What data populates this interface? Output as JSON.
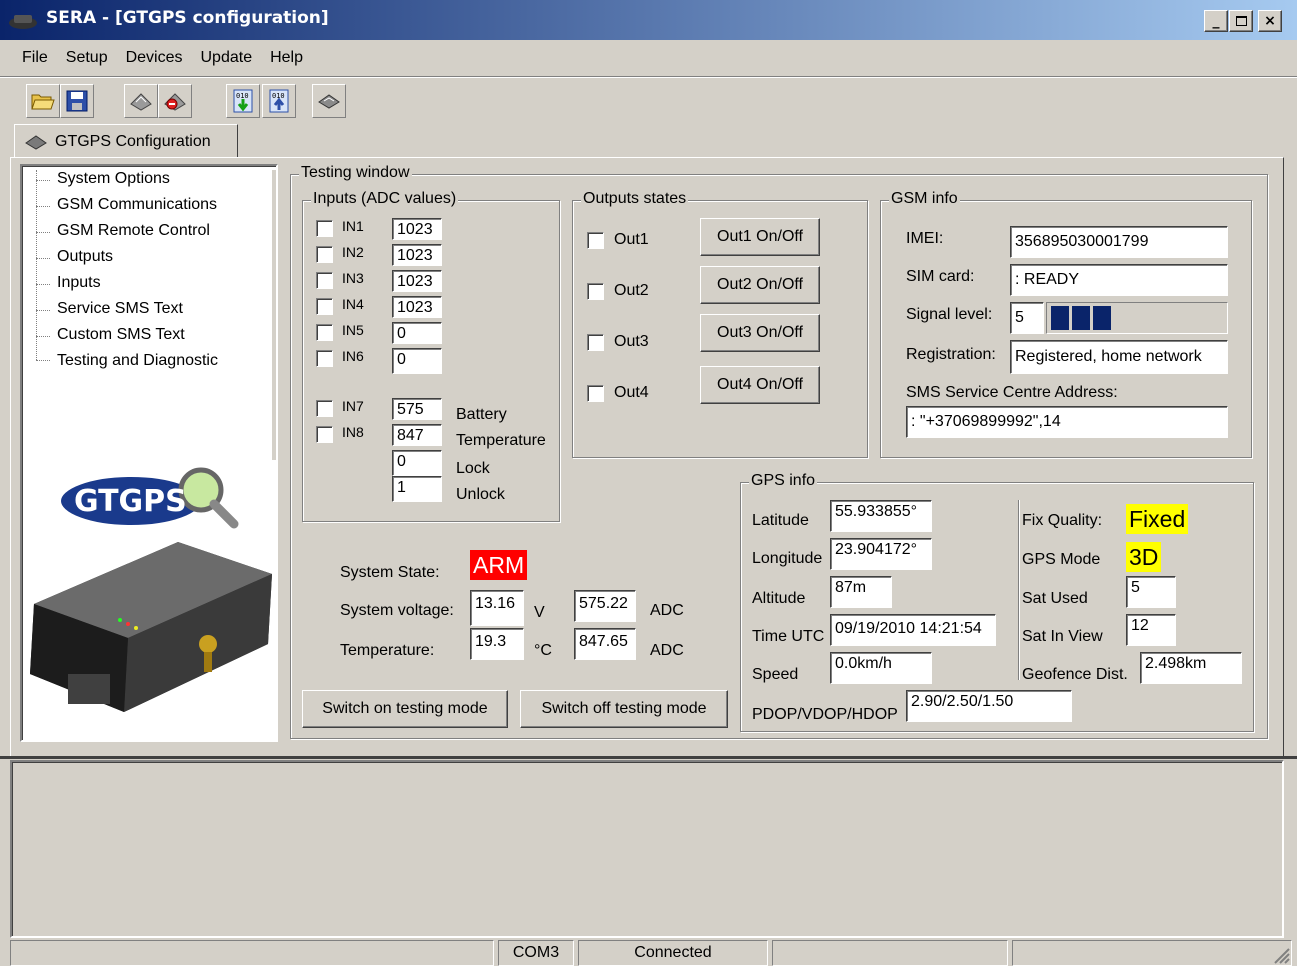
{
  "window": {
    "title": "SERA - [GTGPS configuration]"
  },
  "menu": [
    "File",
    "Setup",
    "Devices",
    "Update",
    "Help"
  ],
  "tab": {
    "label": "GTGPS Configuration"
  },
  "tree": [
    "System Options",
    "GSM Communications",
    "GSM Remote Control",
    "Outputs",
    "Inputs",
    "Service SMS Text",
    "Custom SMS Text",
    "Testing and Diagnostic"
  ],
  "logo": {
    "text": "GTGPS"
  },
  "testing": {
    "title": "Testing window",
    "inputs": {
      "title": "Inputs (ADC values)",
      "items": [
        {
          "name": "IN1",
          "value": "1023"
        },
        {
          "name": "IN2",
          "value": "1023"
        },
        {
          "name": "IN3",
          "value": "1023"
        },
        {
          "name": "IN4",
          "value": "1023"
        },
        {
          "name": "IN5",
          "value": "0"
        },
        {
          "name": "IN6",
          "value": "0"
        },
        {
          "name": "IN7",
          "value": "575",
          "label": "Battery"
        },
        {
          "name": "IN8",
          "value": "847",
          "label": "Temperature"
        }
      ],
      "lock_value": "0",
      "lock_label": "Lock",
      "unlock_value": "1",
      "unlock_label": "Unlock"
    },
    "outputs": {
      "title": "Outputs states",
      "items": [
        {
          "name": "Out1",
          "button": "Out1 On/Off"
        },
        {
          "name": "Out2",
          "button": "Out2 On/Off"
        },
        {
          "name": "Out3",
          "button": "Out3 On/Off"
        },
        {
          "name": "Out4",
          "button": "Out4 On/Off"
        }
      ]
    },
    "gsm": {
      "title": "GSM info",
      "imei_label": "IMEI:",
      "imei": "356895030001799",
      "sim_label": "SIM card:",
      "sim": ": READY",
      "signal_label": "Signal level:",
      "signal": "5",
      "signal_bars": 3,
      "registration_label": "Registration:",
      "registration": "Registered, home network",
      "smsc_label": "SMS Service Centre Address:",
      "smsc": ": \"+37069899992\",14"
    },
    "system": {
      "state_label": "System State:",
      "state": "ARM",
      "voltage_label": "System voltage:",
      "voltage": "13.16",
      "voltage_unit": "V",
      "voltage_adc": "575.22",
      "temp_label": "Temperature:",
      "temp": "19.3",
      "temp_unit": "°C",
      "temp_adc": "847.65",
      "adc_label": "ADC",
      "switch_on": "Switch on testing mode",
      "switch_off": "Switch off testing mode"
    },
    "gps": {
      "title": "GPS info",
      "lat_label": "Latitude",
      "lat": "55.933855°",
      "lon_label": "Longitude",
      "lon": "23.904172°",
      "alt_label": "Altitude",
      "alt": "87m",
      "time_label": "Time UTC",
      "time": "09/19/2010 14:21:54",
      "speed_label": "Speed",
      "speed": "0.0km/h",
      "dop_label": "PDOP/VDOP/HDOP",
      "dop": "2.90/2.50/1.50",
      "fix_label": "Fix Quality:",
      "fix": "Fixed",
      "mode_label": "GPS Mode",
      "mode": "3D",
      "used_label": "Sat Used",
      "used": "5",
      "view_label": "Sat In View",
      "view": "12",
      "geo_label": "Geofence Dist.",
      "geo": "2.498km"
    }
  },
  "statusbar": {
    "port": "COM3",
    "state": "Connected"
  },
  "colors": {
    "title_start": "#0a246a",
    "title_end": "#a6caf0",
    "highlight": "#ffff00",
    "alarm": "#ff0000",
    "signal": "#0a246a"
  }
}
